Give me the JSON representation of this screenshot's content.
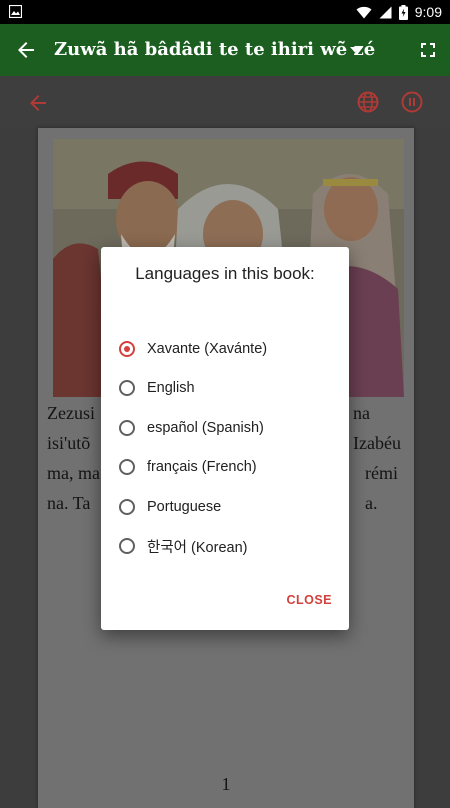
{
  "status_bar": {
    "time": "9:09",
    "icons": [
      "image-notification-icon",
      "wifi-icon",
      "cellular-signal-icon",
      "battery-charging-icon"
    ]
  },
  "app_bar": {
    "title": "Zuwã hã bâdâdi te te ihiri wẽ zé",
    "icons": [
      "back-arrow-icon",
      "dropdown-caret-icon",
      "fullscreen-icon"
    ],
    "background": "#1b5e20"
  },
  "toolbar": {
    "icons": [
      "back-arrow-icon",
      "globe-icon",
      "pause-icon"
    ],
    "accent": "#b03a35"
  },
  "page": {
    "text_lines": [
      "Zezusi",
      "isi'utõ",
      "ma, ma",
      "na. Ta"
    ],
    "text_lines_right": [
      "na",
      "Izabéu",
      "rémi",
      "a."
    ],
    "page_number": "1"
  },
  "language_dialog": {
    "title": "Languages in this book:",
    "options": [
      {
        "label": "Xavante (Xavánte)",
        "selected": true
      },
      {
        "label": "English",
        "selected": false
      },
      {
        "label": "español (Spanish)",
        "selected": false
      },
      {
        "label": "français (French)",
        "selected": false
      },
      {
        "label": "Portuguese",
        "selected": false
      },
      {
        "label": "한국어 (Korean)",
        "selected": false
      }
    ],
    "close_label": "CLOSE",
    "accent": "#d3413d"
  }
}
